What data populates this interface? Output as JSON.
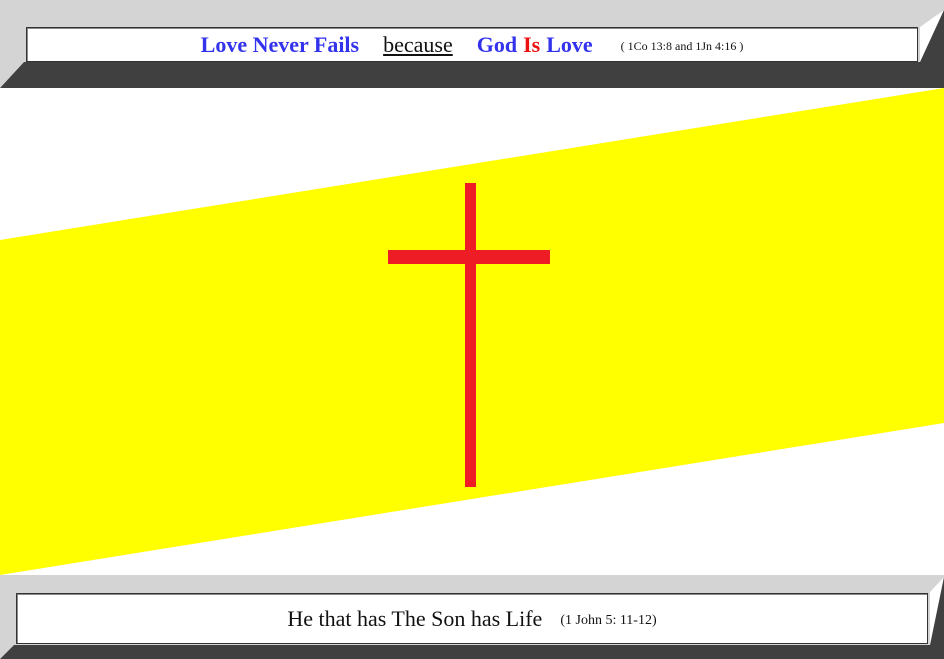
{
  "header": {
    "phrase1": "Love Never Fails",
    "connector": "because",
    "phrase2_god": "God",
    "phrase2_is": "Is",
    "phrase2_love": "Love",
    "reference": "( 1Co 13:8  and  1Jn 4:16 )"
  },
  "footer": {
    "text": "He that has The Son has Life",
    "reference": "(1 John 5: 11-12)"
  },
  "colors": {
    "blue_text": "#3333ee",
    "red_text": "#ee1111",
    "band": "#ffff00",
    "cross": "#ee1c24",
    "frame_light": "#d4d4d4",
    "frame_dark": "#404040"
  },
  "art": {
    "band": "yellow-diagonal-band",
    "symbol": "red-cross"
  }
}
